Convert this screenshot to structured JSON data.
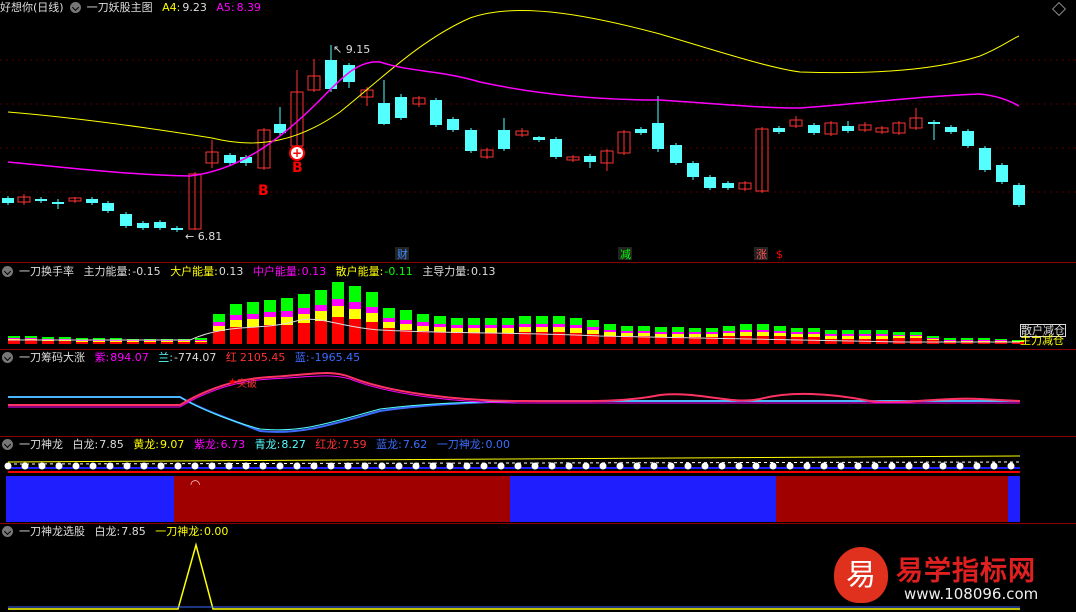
{
  "panels": {
    "main": {
      "title": "好想你(日线)",
      "indicator": "一刀妖股主图",
      "a4_label": "A4:",
      "a4_value": "9.23",
      "a5_label": "A5:",
      "a5_value": "8.39",
      "high_label": "9.15",
      "low_label": "6.81",
      "buy_marks": [
        "B",
        "B"
      ],
      "events": [
        "财",
        "减",
        "涨",
        "$"
      ]
    },
    "turnover": {
      "indicator": "一刀换手率",
      "items": [
        {
          "label": "主力能量:",
          "value": "-0.15"
        },
        {
          "label": "大户能量:",
          "value": "0.13"
        },
        {
          "label": "中户能量:",
          "value": "0.13"
        },
        {
          "label": "散户能量:",
          "value": "-0.11"
        },
        {
          "label": "主导力量:",
          "value": "0.13"
        }
      ],
      "legend_top": "散户减仓",
      "legend_bottom": "主力减仓"
    },
    "chips": {
      "indicator": "一刀筹码大涨",
      "items": [
        {
          "label": "紫:",
          "value": "894.07"
        },
        {
          "label": "兰:",
          "value": "-774.07"
        },
        {
          "label": "红",
          "value": "2105.45"
        },
        {
          "label": "蓝:",
          "value": "-1965.45"
        }
      ],
      "signal": "突破"
    },
    "dragon": {
      "indicator": "一刀神龙",
      "items": [
        {
          "label": "白龙:",
          "value": "7.85"
        },
        {
          "label": "黄龙:",
          "value": "9.07"
        },
        {
          "label": "紫龙:",
          "value": "6.73"
        },
        {
          "label": "青龙:",
          "value": "8.27"
        },
        {
          "label": "红龙:",
          "value": "7.59"
        },
        {
          "label": "蓝龙:",
          "value": "7.62"
        },
        {
          "label": "一刀神龙:",
          "value": "0.00"
        }
      ]
    },
    "select": {
      "indicator": "一刀神龙选股",
      "items": [
        {
          "label": "白龙:",
          "value": "7.85"
        },
        {
          "label": "一刀神龙:",
          "value": "0.00"
        }
      ]
    }
  },
  "watermark": {
    "glyph": "易",
    "name": "易学指标网",
    "url": "www.108096.com"
  },
  "colors": {
    "up": "#ff3232",
    "down": "#54ffff",
    "yellow": "#ffff00",
    "magenta": "#ff00ff",
    "green": "#00ff00",
    "red": "#ff0000",
    "blue": "#1e1eff",
    "darkred": "#a00000"
  }
}
